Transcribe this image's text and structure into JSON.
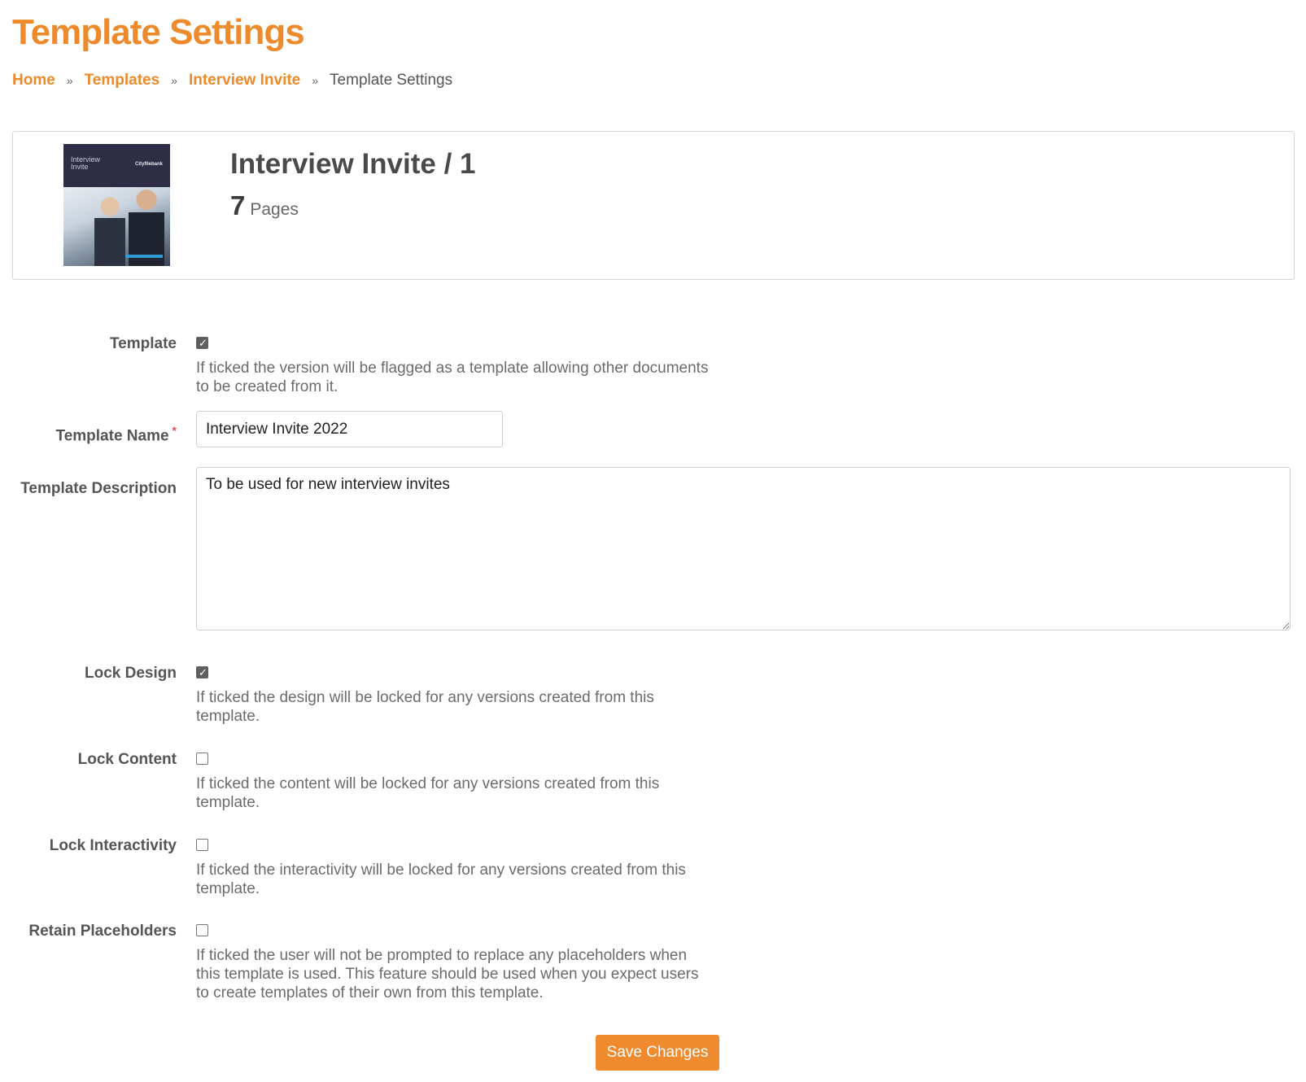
{
  "page": {
    "title": "Template Settings"
  },
  "breadcrumb": {
    "items": [
      {
        "label": "Home"
      },
      {
        "label": "Templates"
      },
      {
        "label": "Interview Invite"
      }
    ],
    "separator": "»",
    "current": "Template Settings"
  },
  "summary": {
    "thumbnail_title": "Interview\nInvite",
    "thumbnail_brand": "Cityfilebank",
    "name": "Interview Invite / 1",
    "pages_count": "7",
    "pages_label": "Pages"
  },
  "form": {
    "template": {
      "label": "Template",
      "checked": true,
      "help": "If ticked the version will be flagged as a template allowing other documents to be created from it."
    },
    "template_name": {
      "label": "Template Name",
      "required_mark": "*",
      "value": "Interview Invite 2022"
    },
    "template_description": {
      "label": "Template Description",
      "value": "To be used for new interview invites"
    },
    "lock_design": {
      "label": "Lock Design",
      "checked": true,
      "help": "If ticked the design will be locked for any versions created from this template."
    },
    "lock_content": {
      "label": "Lock Content",
      "checked": false,
      "help": "If ticked the content will be locked for any versions created from this template."
    },
    "lock_interactivity": {
      "label": "Lock Interactivity",
      "checked": false,
      "help": "If ticked the interactivity will be locked for any versions created from this template."
    },
    "retain_placeholders": {
      "label": "Retain Placeholders",
      "checked": false,
      "help": "If ticked the user will not be prompted to replace any placeholders when this template is used. This feature should be used when you expect users to create templates of their own from this template."
    }
  },
  "actions": {
    "save_label": "Save Changes"
  },
  "colors": {
    "accent": "#ec8a2c",
    "button": "#ef8a2e",
    "checkbox_checked": "#5f5f5f"
  },
  "icons": {
    "check": "check-icon"
  }
}
